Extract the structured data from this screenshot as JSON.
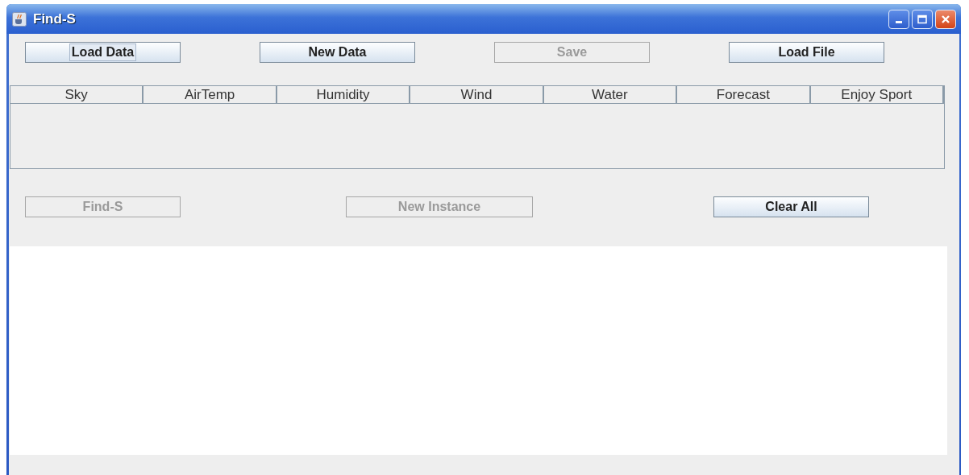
{
  "window": {
    "title": "Find-S"
  },
  "top_buttons": [
    {
      "label": "Load Data",
      "disabled": false,
      "focused": true
    },
    {
      "label": "New Data",
      "disabled": false,
      "focused": false
    },
    {
      "label": "Save",
      "disabled": true,
      "focused": false
    },
    {
      "label": "Load File",
      "disabled": false,
      "focused": false
    }
  ],
  "table": {
    "columns": [
      "Sky",
      "AirTemp",
      "Humidity",
      "Wind",
      "Water",
      "Forecast",
      "Enjoy Sport"
    ]
  },
  "bottom_buttons": [
    {
      "label": "Find-S",
      "disabled": true,
      "focused": false
    },
    {
      "label": "New Instance",
      "disabled": true,
      "focused": false
    },
    {
      "label": "Clear All",
      "disabled": false,
      "focused": false
    }
  ]
}
